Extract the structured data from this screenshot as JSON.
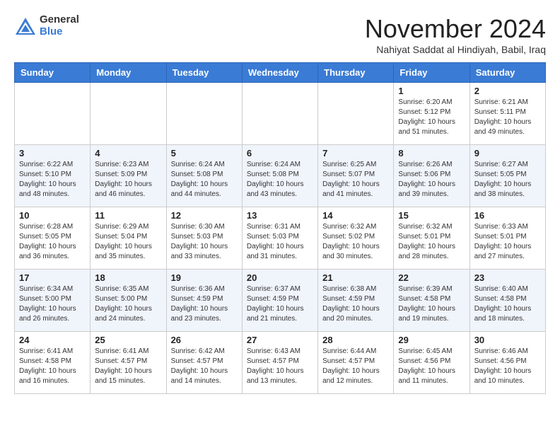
{
  "logo": {
    "general": "General",
    "blue": "Blue"
  },
  "title": "November 2024",
  "location": "Nahiyat Saddat al Hindiyah, Babil, Iraq",
  "headers": [
    "Sunday",
    "Monday",
    "Tuesday",
    "Wednesday",
    "Thursday",
    "Friday",
    "Saturday"
  ],
  "weeks": [
    [
      {
        "day": "",
        "info": ""
      },
      {
        "day": "",
        "info": ""
      },
      {
        "day": "",
        "info": ""
      },
      {
        "day": "",
        "info": ""
      },
      {
        "day": "",
        "info": ""
      },
      {
        "day": "1",
        "info": "Sunrise: 6:20 AM\nSunset: 5:12 PM\nDaylight: 10 hours\nand 51 minutes."
      },
      {
        "day": "2",
        "info": "Sunrise: 6:21 AM\nSunset: 5:11 PM\nDaylight: 10 hours\nand 49 minutes."
      }
    ],
    [
      {
        "day": "3",
        "info": "Sunrise: 6:22 AM\nSunset: 5:10 PM\nDaylight: 10 hours\nand 48 minutes."
      },
      {
        "day": "4",
        "info": "Sunrise: 6:23 AM\nSunset: 5:09 PM\nDaylight: 10 hours\nand 46 minutes."
      },
      {
        "day": "5",
        "info": "Sunrise: 6:24 AM\nSunset: 5:08 PM\nDaylight: 10 hours\nand 44 minutes."
      },
      {
        "day": "6",
        "info": "Sunrise: 6:24 AM\nSunset: 5:08 PM\nDaylight: 10 hours\nand 43 minutes."
      },
      {
        "day": "7",
        "info": "Sunrise: 6:25 AM\nSunset: 5:07 PM\nDaylight: 10 hours\nand 41 minutes."
      },
      {
        "day": "8",
        "info": "Sunrise: 6:26 AM\nSunset: 5:06 PM\nDaylight: 10 hours\nand 39 minutes."
      },
      {
        "day": "9",
        "info": "Sunrise: 6:27 AM\nSunset: 5:05 PM\nDaylight: 10 hours\nand 38 minutes."
      }
    ],
    [
      {
        "day": "10",
        "info": "Sunrise: 6:28 AM\nSunset: 5:05 PM\nDaylight: 10 hours\nand 36 minutes."
      },
      {
        "day": "11",
        "info": "Sunrise: 6:29 AM\nSunset: 5:04 PM\nDaylight: 10 hours\nand 35 minutes."
      },
      {
        "day": "12",
        "info": "Sunrise: 6:30 AM\nSunset: 5:03 PM\nDaylight: 10 hours\nand 33 minutes."
      },
      {
        "day": "13",
        "info": "Sunrise: 6:31 AM\nSunset: 5:03 PM\nDaylight: 10 hours\nand 31 minutes."
      },
      {
        "day": "14",
        "info": "Sunrise: 6:32 AM\nSunset: 5:02 PM\nDaylight: 10 hours\nand 30 minutes."
      },
      {
        "day": "15",
        "info": "Sunrise: 6:32 AM\nSunset: 5:01 PM\nDaylight: 10 hours\nand 28 minutes."
      },
      {
        "day": "16",
        "info": "Sunrise: 6:33 AM\nSunset: 5:01 PM\nDaylight: 10 hours\nand 27 minutes."
      }
    ],
    [
      {
        "day": "17",
        "info": "Sunrise: 6:34 AM\nSunset: 5:00 PM\nDaylight: 10 hours\nand 26 minutes."
      },
      {
        "day": "18",
        "info": "Sunrise: 6:35 AM\nSunset: 5:00 PM\nDaylight: 10 hours\nand 24 minutes."
      },
      {
        "day": "19",
        "info": "Sunrise: 6:36 AM\nSunset: 4:59 PM\nDaylight: 10 hours\nand 23 minutes."
      },
      {
        "day": "20",
        "info": "Sunrise: 6:37 AM\nSunset: 4:59 PM\nDaylight: 10 hours\nand 21 minutes."
      },
      {
        "day": "21",
        "info": "Sunrise: 6:38 AM\nSunset: 4:59 PM\nDaylight: 10 hours\nand 20 minutes."
      },
      {
        "day": "22",
        "info": "Sunrise: 6:39 AM\nSunset: 4:58 PM\nDaylight: 10 hours\nand 19 minutes."
      },
      {
        "day": "23",
        "info": "Sunrise: 6:40 AM\nSunset: 4:58 PM\nDaylight: 10 hours\nand 18 minutes."
      }
    ],
    [
      {
        "day": "24",
        "info": "Sunrise: 6:41 AM\nSunset: 4:58 PM\nDaylight: 10 hours\nand 16 minutes."
      },
      {
        "day": "25",
        "info": "Sunrise: 6:41 AM\nSunset: 4:57 PM\nDaylight: 10 hours\nand 15 minutes."
      },
      {
        "day": "26",
        "info": "Sunrise: 6:42 AM\nSunset: 4:57 PM\nDaylight: 10 hours\nand 14 minutes."
      },
      {
        "day": "27",
        "info": "Sunrise: 6:43 AM\nSunset: 4:57 PM\nDaylight: 10 hours\nand 13 minutes."
      },
      {
        "day": "28",
        "info": "Sunrise: 6:44 AM\nSunset: 4:57 PM\nDaylight: 10 hours\nand 12 minutes."
      },
      {
        "day": "29",
        "info": "Sunrise: 6:45 AM\nSunset: 4:56 PM\nDaylight: 10 hours\nand 11 minutes."
      },
      {
        "day": "30",
        "info": "Sunrise: 6:46 AM\nSunset: 4:56 PM\nDaylight: 10 hours\nand 10 minutes."
      }
    ]
  ]
}
